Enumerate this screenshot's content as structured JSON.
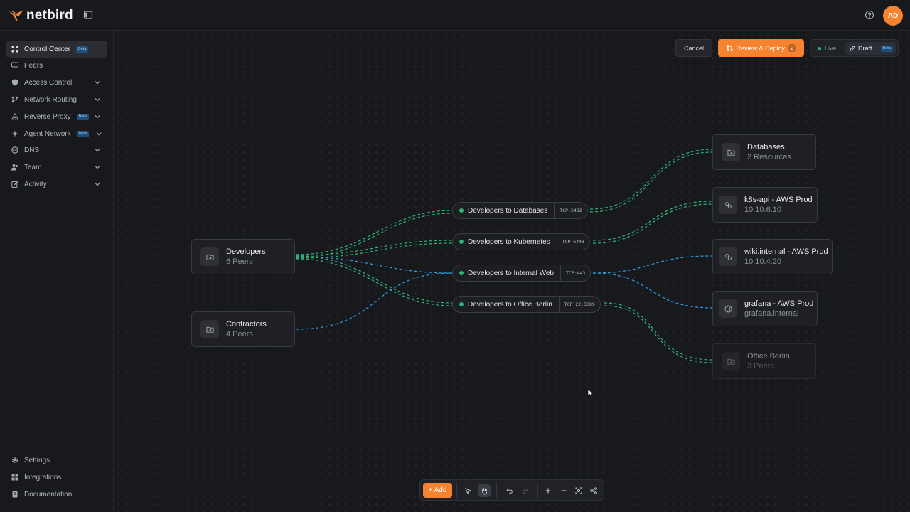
{
  "header": {
    "logo_text": "netbird",
    "avatar_initials": "AD"
  },
  "sidebar": {
    "items": [
      {
        "label": "Control Center",
        "badge": "Beta",
        "icon": "grid-icon"
      },
      {
        "label": "Peers",
        "icon": "monitor-icon"
      },
      {
        "label": "Access Control",
        "icon": "shield-icon"
      },
      {
        "label": "Network Routing",
        "icon": "branch-icon"
      },
      {
        "label": "Reverse Proxy",
        "badge": "Beta",
        "icon": "proxy-icon"
      },
      {
        "label": "Agent Network",
        "badge": "Beta",
        "icon": "sparkle-icon"
      },
      {
        "label": "DNS",
        "icon": "globe-icon"
      },
      {
        "label": "Team",
        "icon": "users-icon"
      },
      {
        "label": "Activity",
        "icon": "activity-icon"
      }
    ],
    "bottom": [
      {
        "label": "Settings",
        "icon": "gear-icon"
      },
      {
        "label": "Integrations",
        "icon": "puzzle-icon"
      },
      {
        "label": "Documentation",
        "icon": "book-icon"
      }
    ]
  },
  "actions": {
    "cancel_label": "Cancel",
    "deploy_label": "Review & Deploy",
    "deploy_count": "2",
    "live_label": "Live",
    "draft_label": "Draft",
    "draft_badge": "Beta"
  },
  "graph": {
    "sources": [
      {
        "title": "Developers",
        "subtitle": "6 Peers"
      },
      {
        "title": "Contractors",
        "subtitle": "4 Peers"
      }
    ],
    "policies": [
      {
        "label": "Developers to Databases",
        "port": "TCP:5432"
      },
      {
        "label": "Developers to Kubernetes",
        "port": "TCP:6443"
      },
      {
        "label": "Developers to Internal Web",
        "port": "TCP:443"
      },
      {
        "label": "Developers to Office Berlin",
        "port": "TCP:22,3389"
      }
    ],
    "destinations": [
      {
        "title": "Databases",
        "subtitle": "2 Resources"
      },
      {
        "title": "k8s-api  -  AWS Prod",
        "subtitle": "10.10.6.10"
      },
      {
        "title": "wiki.internal  -  AWS Prod",
        "subtitle": "10.10.4.20"
      },
      {
        "title": "grafana  -  AWS Prod",
        "subtitle": "grafana.internal"
      },
      {
        "title": "Office Berlin",
        "subtitle": "3 Peers"
      }
    ]
  },
  "toolbar": {
    "add_label": "+ Add"
  },
  "colors": {
    "accent": "#f68330",
    "edge_green": "#2fb47a",
    "edge_blue": "#2d9ee0"
  }
}
